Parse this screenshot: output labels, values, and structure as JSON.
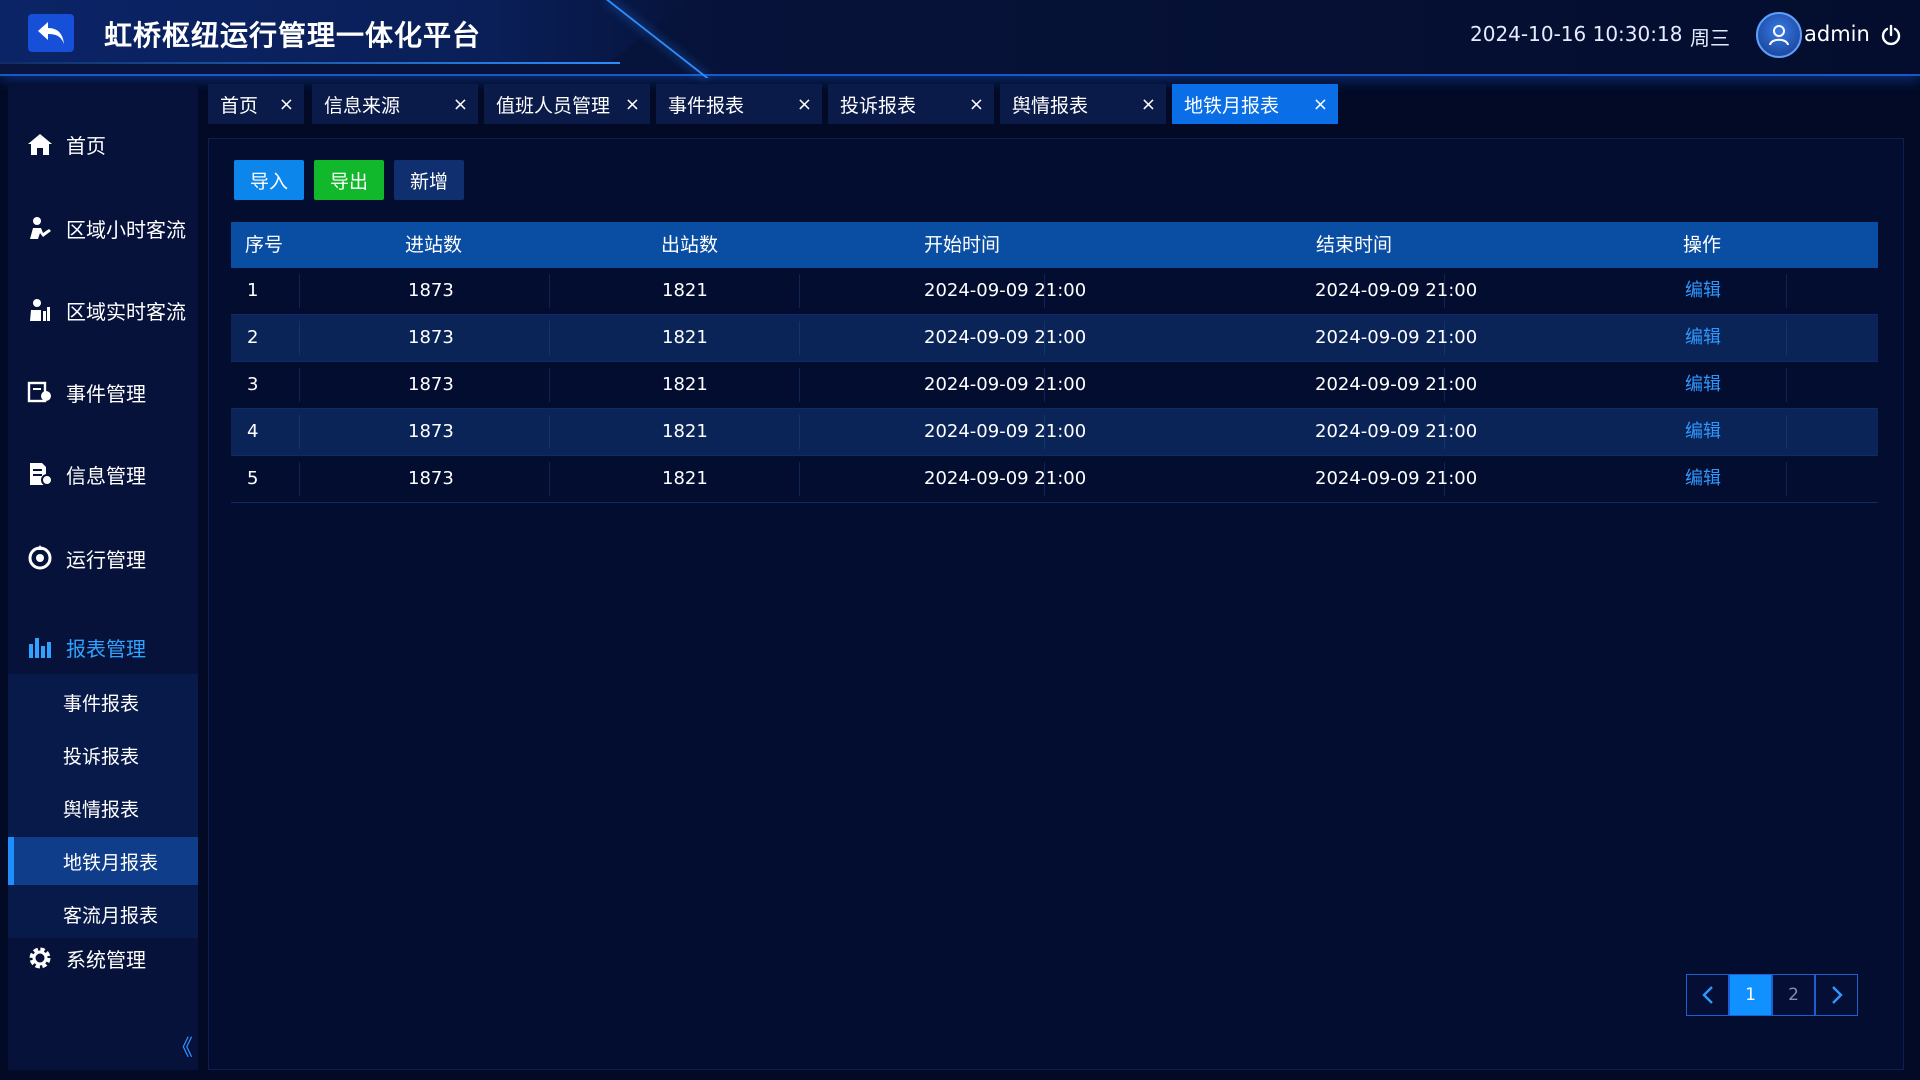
{
  "header": {
    "title": "虹桥枢纽运行管理一体化平台",
    "datetime": "2024-10-16 10:30:18",
    "weekday": "周三",
    "username": "admin",
    "icons": [
      "back-arrow-icon",
      "user-avatar-icon",
      "power-icon"
    ]
  },
  "sidebar": {
    "items": [
      {
        "label": "首页",
        "icon": "home-icon"
      },
      {
        "label": "区域小时客流",
        "icon": "hourly-flow-icon"
      },
      {
        "label": "区域实时客流",
        "icon": "realtime-flow-icon"
      },
      {
        "label": "事件管理",
        "icon": "event-icon"
      },
      {
        "label": "信息管理",
        "icon": "info-icon"
      },
      {
        "label": "运行管理",
        "icon": "operation-icon"
      },
      {
        "label": "报表管理",
        "icon": "chart-bar-icon"
      },
      {
        "label": "系统管理",
        "icon": "gear-icon"
      }
    ],
    "report_sub": [
      {
        "label": "事件报表"
      },
      {
        "label": "投诉报表"
      },
      {
        "label": "舆情报表"
      },
      {
        "label": "地铁月报表"
      },
      {
        "label": "客流月报表"
      }
    ],
    "collapse": "《"
  },
  "tabs": [
    {
      "label": "首页",
      "close": "×"
    },
    {
      "label": "信息来源",
      "close": "×"
    },
    {
      "label": "值班人员管理",
      "close": "×"
    },
    {
      "label": "事件报表",
      "close": "×"
    },
    {
      "label": "投诉报表",
      "close": "×"
    },
    {
      "label": "舆情报表",
      "close": "×"
    },
    {
      "label": "地铁月报表",
      "close": "×"
    }
  ],
  "toolbar": {
    "import_label": "导入",
    "export_label": "导出",
    "add_label": "新增"
  },
  "table": {
    "columns": [
      "序号",
      "进站数",
      "出站数",
      "开始时间",
      "结束时间",
      "操作"
    ],
    "rows": [
      {
        "no": "1",
        "in": "1873",
        "out": "1821",
        "start": "2024-09-09 21:00",
        "end": "2024-09-09 21:00",
        "action": "编辑"
      },
      {
        "no": "2",
        "in": "1873",
        "out": "1821",
        "start": "2024-09-09 21:00",
        "end": "2024-09-09 21:00",
        "action": "编辑"
      },
      {
        "no": "3",
        "in": "1873",
        "out": "1821",
        "start": "2024-09-09 21:00",
        "end": "2024-09-09 21:00",
        "action": "编辑"
      },
      {
        "no": "4",
        "in": "1873",
        "out": "1821",
        "start": "2024-09-09 21:00",
        "end": "2024-09-09 21:00",
        "action": "编辑"
      },
      {
        "no": "5",
        "in": "1873",
        "out": "1821",
        "start": "2024-09-09 21:00",
        "end": "2024-09-09 21:00",
        "action": "编辑"
      }
    ]
  },
  "pagination": {
    "pages": [
      "1",
      "2"
    ],
    "current": "1"
  },
  "colors": {
    "accent": "#1190ff",
    "active_tab": "#0a6fe6",
    "export_green": "#11b82b",
    "link": "#2f98ff"
  }
}
